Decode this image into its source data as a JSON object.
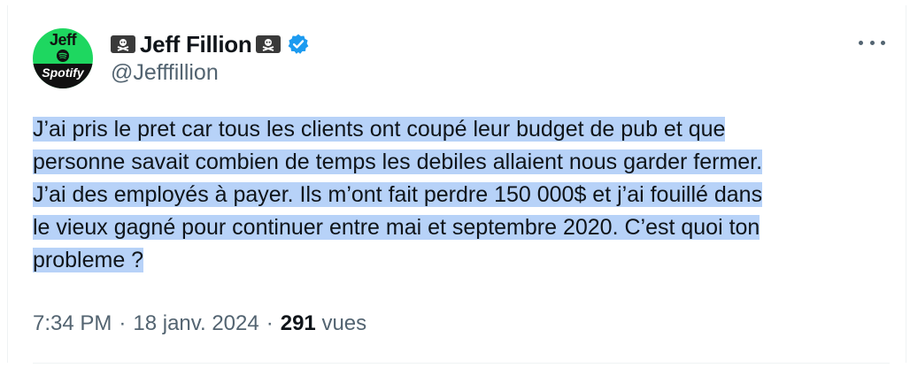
{
  "author": {
    "avatar": {
      "top_text": "Jeff",
      "bottom_text": "Spotify"
    },
    "display_name": "Jeff Fillion",
    "handle": "@Jefffillion",
    "verified": true,
    "name_decoration_icon": "skull-crossbones-flag-icon"
  },
  "menu": {
    "icon": "more-options-icon"
  },
  "tweet": {
    "lines": [
      "J’ai pris le pret car tous les clients ont coupé leur budget de pub et que",
      "personne savait combien de temps les debiles allaient nous garder fermer.",
      "J’ai des employés à payer. Ils m’ont fait perdre 150 000$ et  j’ai fouillé dans",
      "le vieux gagné pour continuer entre mai et septembre 2020. C’est quoi ton",
      "probleme ?"
    ],
    "highlight_color": "#b7d2f8"
  },
  "meta": {
    "time": "7:34 PM",
    "date": "18 janv. 2024",
    "views_count": "291",
    "views_label": "vues",
    "separator": "·"
  },
  "colors": {
    "text_primary": "#0f1419",
    "text_secondary": "#536471",
    "verified_blue": "#1d9bf0",
    "avatar_green": "#1ed760"
  }
}
